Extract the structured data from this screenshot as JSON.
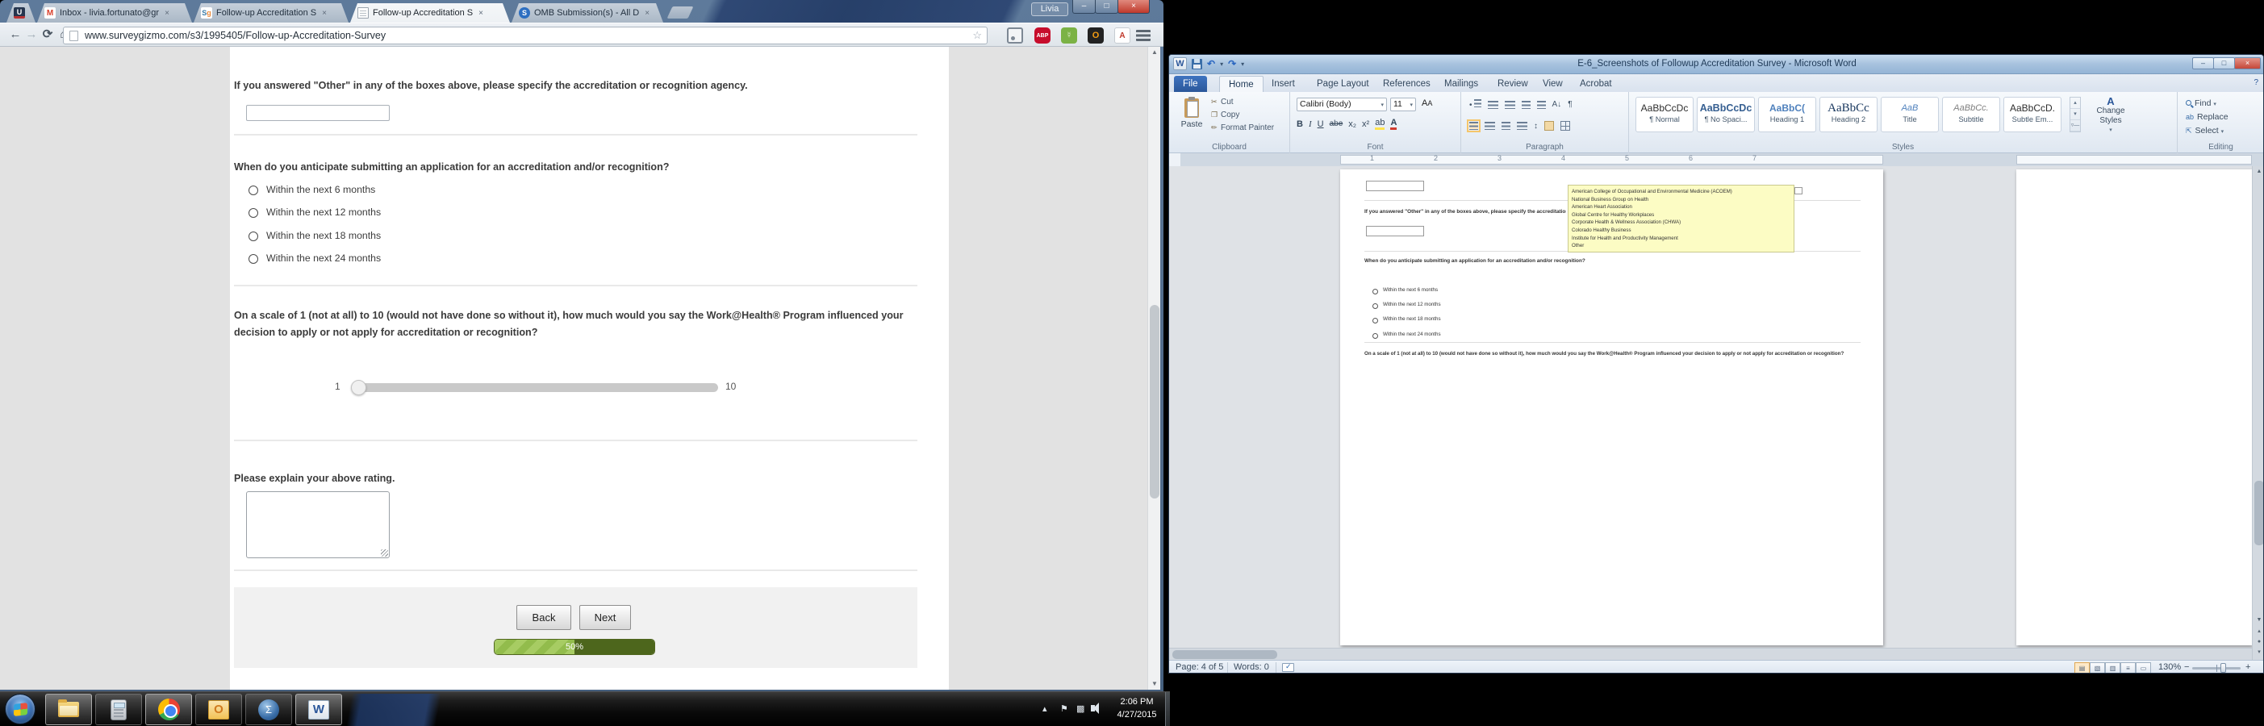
{
  "browser": {
    "tabs": [
      {
        "label": "",
        "icon": "u-pinned"
      },
      {
        "label": "Inbox - livia.fortunato@gr",
        "icon": "gmail"
      },
      {
        "label": "Follow-up Accreditation S",
        "icon": "surveygizmo"
      },
      {
        "label": "Follow-up Accreditation S",
        "icon": "document",
        "active": true
      },
      {
        "label": "OMB Submission(s) - All D",
        "icon": "omb"
      }
    ],
    "close_glyph": "×",
    "profile_label": "Livia",
    "url": "www.surveygizmo.com/s3/1995405/Follow-up-Accreditation-Survey",
    "icons": {
      "back": "←",
      "forward": "→",
      "reload": "⟳",
      "home": "⌂",
      "star": "☆",
      "abp": "ABP",
      "evernote": "☿",
      "oo": "O",
      "pdf": "A",
      "min": "–",
      "max": "□",
      "close": "×",
      "scroll_up": "▲",
      "scroll_down": "▼"
    }
  },
  "survey": {
    "q_other_label": "If you answered \"Other\" in any of the boxes above, please specify the accreditation or recognition agency.",
    "q_when_label": "When do you anticipate submitting an application for an accreditation and/or recognition?",
    "when_options": [
      "Within the next 6 months",
      "Within the next 12 months",
      "Within the next 18 months",
      "Within the next 24 months"
    ],
    "q_scale_label": "On a scale of 1 (not at all) to 10 (would not have done so without it), how much would you say the Work@Health® Program influenced your decision to apply or not apply for accreditation or recognition?",
    "scale_min": "1",
    "scale_max": "10",
    "q_explain_label": "Please explain your above rating.",
    "back_label": "Back",
    "next_label": "Next",
    "progress_label": "50%"
  },
  "word": {
    "title": "E-6_Screenshots of Followup Accreditation Survey - Microsoft Word",
    "tabs": [
      "File",
      "Home",
      "Insert",
      "Page Layout",
      "References",
      "Mailings",
      "Review",
      "View",
      "Acrobat"
    ],
    "help_glyph": "?",
    "qat": {
      "undo": "↶",
      "redo": "↷",
      "caret": "▾"
    },
    "clipboard": {
      "label": "Clipboard",
      "paste": "Paste",
      "cut": "Cut",
      "copy": "Copy",
      "format_painter": "Format Painter",
      "cut_glyph": "✂"
    },
    "font": {
      "label": "Font",
      "name": "Calibri (Body)",
      "size": "11",
      "b": "B",
      "i": "I",
      "u": "U",
      "strike": "abe",
      "sub": "x₂",
      "sup": "x²",
      "grow": "A",
      "shrink": "A",
      "hl": "ab",
      "color": "A"
    },
    "paragraph": {
      "label": "Paragraph",
      "pilcrow": "¶",
      "sort": "A↓",
      "spacing": "↕",
      "bullet": "•"
    },
    "styles": {
      "label": "Styles",
      "change": "Change Styles",
      "change_icon": "A",
      "caret": "▾",
      "items": [
        {
          "s": "AaBbCcDc",
          "n": "¶ Normal"
        },
        {
          "s": "AaBbCcDc",
          "n": "¶ No Spaci..."
        },
        {
          "s": "AaBbC(",
          "n": "Heading 1"
        },
        {
          "s": "AaBbCc",
          "n": "Heading 2"
        },
        {
          "s": "AaB",
          "n": "Title"
        },
        {
          "s": "AaBbCc.",
          "n": "Subtitle"
        },
        {
          "s": "AaBbCcD.",
          "n": "Subtle Em..."
        }
      ]
    },
    "editing": {
      "label": "Editing",
      "find": "Find",
      "replace": "Replace",
      "select": "Select",
      "replace_glyph": "ab",
      "select_glyph": "⇱"
    },
    "ruler_numbers": [
      "1",
      "2",
      "3",
      "4",
      "5",
      "6",
      "7"
    ],
    "status": {
      "page": "Page: 4 of 5",
      "words": "Words: 0",
      "zoom": "130%",
      "zoom_minus": "−",
      "zoom_plus": "+"
    },
    "view_icons": [
      "▤",
      "▧",
      "▥",
      "≡",
      "▭"
    ],
    "scroll_glyphs": {
      "up": "▲",
      "down": "▼",
      "prev": "▴",
      "ball": "●",
      "next": "▾"
    },
    "doc": {
      "yellow_items": [
        "American College of Occupational and Environmental Medicine (ACOEM)",
        "National Business Group on Health",
        "American Heart Association",
        "Global Centre for Healthy Workplaces",
        "Corporate Health & Wellness Association (CHWA)",
        "Colorado Healthy Business",
        "Institute for Health and Productivity Management",
        "Other"
      ]
    }
  },
  "taskbar": {
    "time": "2:06 PM",
    "date": "4/27/2015",
    "tray_chevron": "▴",
    "tray_flag": "⚑"
  }
}
